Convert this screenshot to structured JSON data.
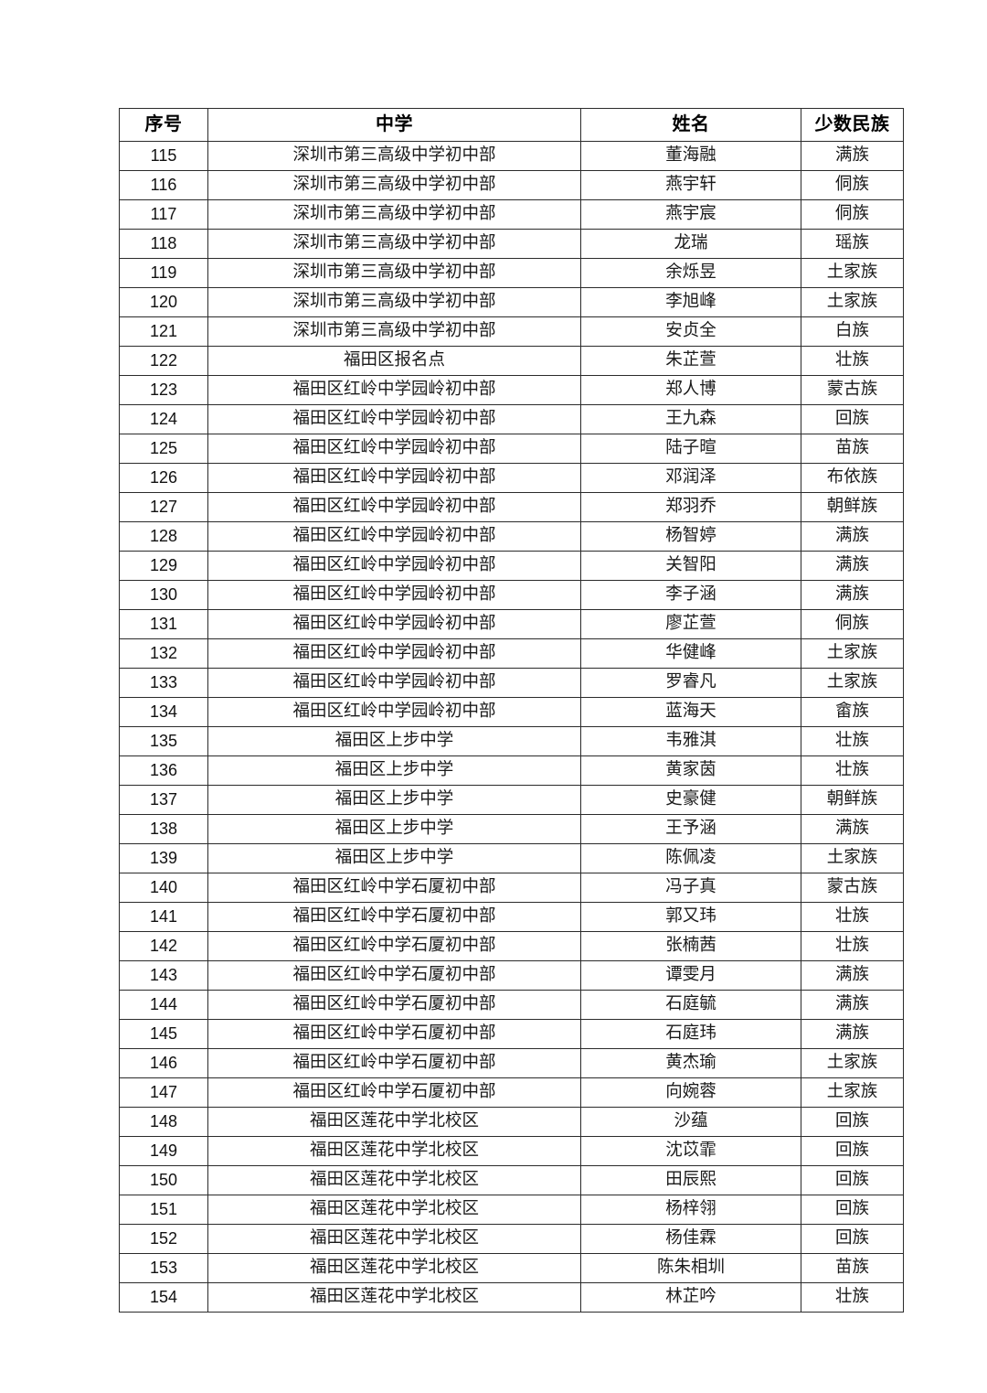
{
  "document": {
    "type": "roster-table",
    "page_background": "#ffffff",
    "border_color": "#2b2b2b"
  },
  "table": {
    "columns": [
      {
        "key": "seq",
        "label": "序号"
      },
      {
        "key": "school",
        "label": "中学"
      },
      {
        "key": "name",
        "label": "姓名"
      },
      {
        "key": "ethn",
        "label": "少数民族"
      }
    ],
    "rows": [
      {
        "seq": "115",
        "school": "深圳市第三高级中学初中部",
        "name": "董海融",
        "ethn": "满族"
      },
      {
        "seq": "116",
        "school": "深圳市第三高级中学初中部",
        "name": "燕宇轩",
        "ethn": "侗族"
      },
      {
        "seq": "117",
        "school": "深圳市第三高级中学初中部",
        "name": "燕宇宸",
        "ethn": "侗族"
      },
      {
        "seq": "118",
        "school": "深圳市第三高级中学初中部",
        "name": "龙瑞",
        "ethn": "瑶族"
      },
      {
        "seq": "119",
        "school": "深圳市第三高级中学初中部",
        "name": "余烁昱",
        "ethn": "土家族"
      },
      {
        "seq": "120",
        "school": "深圳市第三高级中学初中部",
        "name": "李旭峰",
        "ethn": "土家族"
      },
      {
        "seq": "121",
        "school": "深圳市第三高级中学初中部",
        "name": "安贞全",
        "ethn": "白族"
      },
      {
        "seq": "122",
        "school": "福田区报名点",
        "name": "朱芷萱",
        "ethn": "壮族"
      },
      {
        "seq": "123",
        "school": "福田区红岭中学园岭初中部",
        "name": "郑人博",
        "ethn": "蒙古族"
      },
      {
        "seq": "124",
        "school": "福田区红岭中学园岭初中部",
        "name": "王九森",
        "ethn": "回族"
      },
      {
        "seq": "125",
        "school": "福田区红岭中学园岭初中部",
        "name": "陆子暄",
        "ethn": "苗族"
      },
      {
        "seq": "126",
        "school": "福田区红岭中学园岭初中部",
        "name": "邓润泽",
        "ethn": "布依族"
      },
      {
        "seq": "127",
        "school": "福田区红岭中学园岭初中部",
        "name": "郑羽乔",
        "ethn": "朝鲜族"
      },
      {
        "seq": "128",
        "school": "福田区红岭中学园岭初中部",
        "name": "杨智婷",
        "ethn": "满族"
      },
      {
        "seq": "129",
        "school": "福田区红岭中学园岭初中部",
        "name": "关智阳",
        "ethn": "满族"
      },
      {
        "seq": "130",
        "school": "福田区红岭中学园岭初中部",
        "name": "李子涵",
        "ethn": "满族"
      },
      {
        "seq": "131",
        "school": "福田区红岭中学园岭初中部",
        "name": "廖芷萱",
        "ethn": "侗族"
      },
      {
        "seq": "132",
        "school": "福田区红岭中学园岭初中部",
        "name": "华健峰",
        "ethn": "土家族"
      },
      {
        "seq": "133",
        "school": "福田区红岭中学园岭初中部",
        "name": "罗睿凡",
        "ethn": "土家族"
      },
      {
        "seq": "134",
        "school": "福田区红岭中学园岭初中部",
        "name": "蓝海天",
        "ethn": "畲族"
      },
      {
        "seq": "135",
        "school": "福田区上步中学",
        "name": "韦雅淇",
        "ethn": "壮族"
      },
      {
        "seq": "136",
        "school": "福田区上步中学",
        "name": "黄家茵",
        "ethn": "壮族"
      },
      {
        "seq": "137",
        "school": "福田区上步中学",
        "name": "史豪健",
        "ethn": "朝鲜族"
      },
      {
        "seq": "138",
        "school": "福田区上步中学",
        "name": "王予涵",
        "ethn": "满族"
      },
      {
        "seq": "139",
        "school": "福田区上步中学",
        "name": "陈佩凌",
        "ethn": "土家族"
      },
      {
        "seq": "140",
        "school": "福田区红岭中学石厦初中部",
        "name": "冯子真",
        "ethn": "蒙古族"
      },
      {
        "seq": "141",
        "school": "福田区红岭中学石厦初中部",
        "name": "郭又玮",
        "ethn": "壮族"
      },
      {
        "seq": "142",
        "school": "福田区红岭中学石厦初中部",
        "name": "张楠茜",
        "ethn": "壮族"
      },
      {
        "seq": "143",
        "school": "福田区红岭中学石厦初中部",
        "name": "谭雯月",
        "ethn": "满族"
      },
      {
        "seq": "144",
        "school": "福田区红岭中学石厦初中部",
        "name": "石庭毓",
        "ethn": "满族"
      },
      {
        "seq": "145",
        "school": "福田区红岭中学石厦初中部",
        "name": "石庭玮",
        "ethn": "满族"
      },
      {
        "seq": "146",
        "school": "福田区红岭中学石厦初中部",
        "name": "黄杰瑜",
        "ethn": "土家族"
      },
      {
        "seq": "147",
        "school": "福田区红岭中学石厦初中部",
        "name": "向婉蓉",
        "ethn": "土家族"
      },
      {
        "seq": "148",
        "school": "福田区莲花中学北校区",
        "name": "沙蕴",
        "ethn": "回族"
      },
      {
        "seq": "149",
        "school": "福田区莲花中学北校区",
        "name": "沈苡霏",
        "ethn": "回族"
      },
      {
        "seq": "150",
        "school": "福田区莲花中学北校区",
        "name": "田辰熙",
        "ethn": "回族"
      },
      {
        "seq": "151",
        "school": "福田区莲花中学北校区",
        "name": "杨梓翎",
        "ethn": "回族"
      },
      {
        "seq": "152",
        "school": "福田区莲花中学北校区",
        "name": "杨佳霖",
        "ethn": "回族"
      },
      {
        "seq": "153",
        "school": "福田区莲花中学北校区",
        "name": "陈朱相圳",
        "ethn": "苗族"
      },
      {
        "seq": "154",
        "school": "福田区莲花中学北校区",
        "name": "林芷吟",
        "ethn": "壮族"
      }
    ]
  }
}
